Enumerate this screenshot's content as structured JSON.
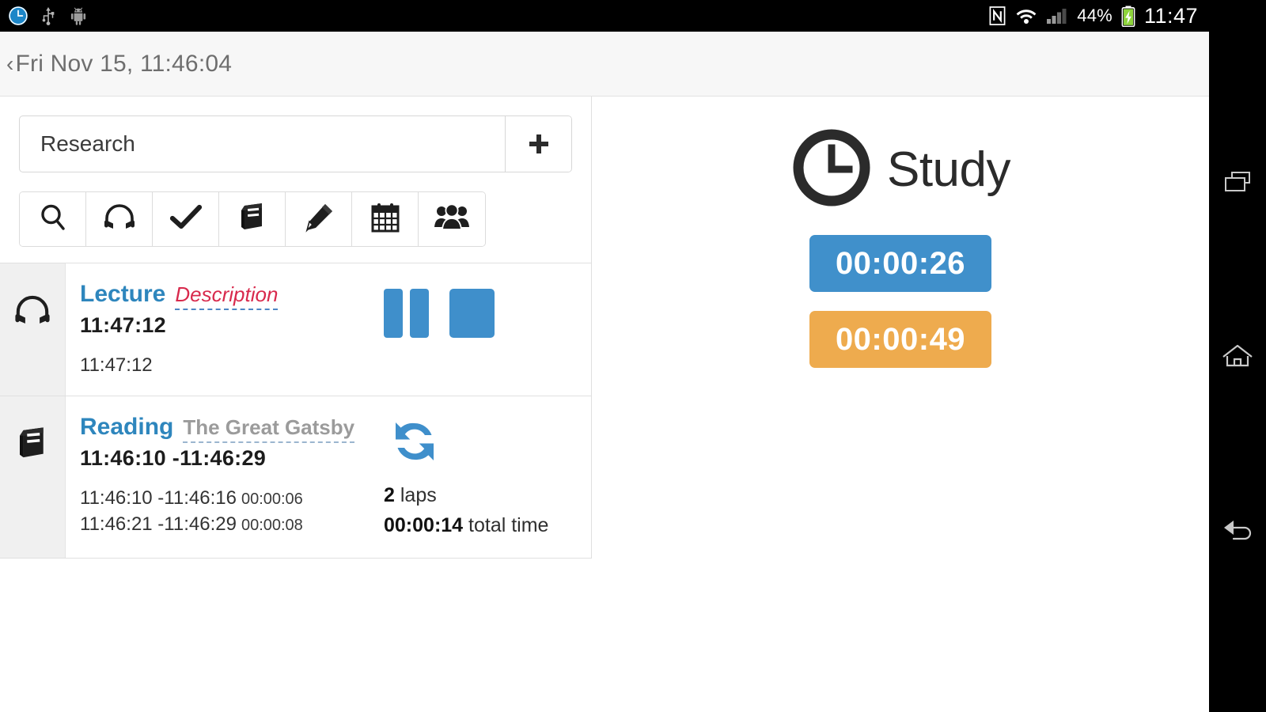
{
  "statusbar": {
    "left_icons": [
      "clock-icon",
      "usb-icon",
      "android-robot-icon"
    ],
    "right_icons": [
      "nfc-icon",
      "wifi-icon",
      "signal-icon",
      "battery-charging-icon"
    ],
    "battery_percent": "44%",
    "clock": "11:47"
  },
  "navbar": {
    "recents_label": "recent-apps",
    "home_label": "home",
    "back_label": "back"
  },
  "topbar": {
    "back_chevron": "‹",
    "breadcrumb": "Fri Nov 15, 11:46:04"
  },
  "controls": {
    "new_task_value": "Research",
    "new_task_placeholder": "Research",
    "add_button_label": "+",
    "type_buttons": [
      {
        "name": "search-icon",
        "label": "Search"
      },
      {
        "name": "headphones-icon",
        "label": "Listening"
      },
      {
        "name": "check-icon",
        "label": "Task"
      },
      {
        "name": "book-icon",
        "label": "Reading"
      },
      {
        "name": "pencil-icon",
        "label": "Writing"
      },
      {
        "name": "calendar-icon",
        "label": "Calendar"
      },
      {
        "name": "people-icon",
        "label": "Group"
      }
    ]
  },
  "entries": [
    {
      "icon": "headphones-icon",
      "name": "Lecture",
      "description": "Description",
      "description_style": "red-italic",
      "time_main": "11:47:12",
      "laps": [
        {
          "range": "11:47:12",
          "duration": ""
        }
      ],
      "running": true,
      "controls": {
        "pause": "pause-button",
        "stop": "stop-button"
      }
    },
    {
      "icon": "book-icon",
      "name": "Reading",
      "description": "The Great Gatsby",
      "description_style": "grey-bold",
      "time_main": "11:46:10 -11:46:29",
      "laps": [
        {
          "range": "11:46:10 -11:46:16",
          "duration": "00:00:06"
        },
        {
          "range": "11:46:21 -11:46:29",
          "duration": "00:00:08"
        }
      ],
      "running": false,
      "lap_count": "2",
      "lap_count_suffix": "laps",
      "total_time": "00:00:14",
      "total_time_suffix": "total time",
      "restart_icon": "refresh-icon"
    }
  ],
  "active": {
    "icon": "clock-icon",
    "title": "Study",
    "elapsed": "00:00:26",
    "total": "00:00:49"
  },
  "colors": {
    "accent_blue": "#4090cb",
    "accent_orange": "#eeab4e",
    "task_title_blue": "#2e86bd",
    "description_red": "#d8294c",
    "description_grey": "#9b9b9b"
  }
}
